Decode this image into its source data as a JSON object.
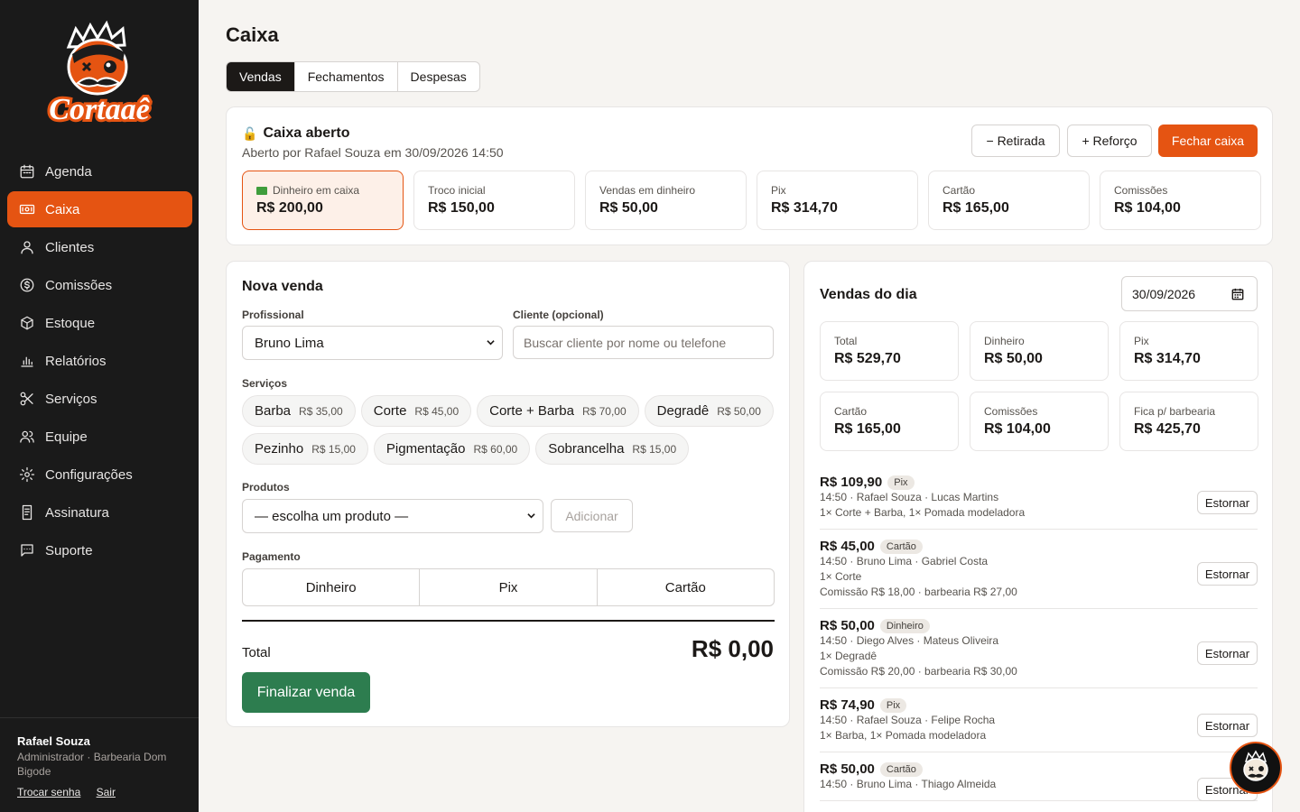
{
  "app": {
    "brand": "Cortaaê"
  },
  "sidebar": {
    "items": [
      {
        "label": "Agenda",
        "icon": "calendar-icon"
      },
      {
        "label": "Caixa",
        "icon": "cash-register-icon"
      },
      {
        "label": "Clientes",
        "icon": "user-icon"
      },
      {
        "label": "Comissões",
        "icon": "dollar-circle-icon"
      },
      {
        "label": "Estoque",
        "icon": "box-icon"
      },
      {
        "label": "Relatórios",
        "icon": "bar-chart-icon"
      },
      {
        "label": "Serviços",
        "icon": "scissors-icon"
      },
      {
        "label": "Equipe",
        "icon": "users-icon"
      },
      {
        "label": "Configurações",
        "icon": "gear-icon"
      },
      {
        "label": "Assinatura",
        "icon": "receipt-icon"
      },
      {
        "label": "Suporte",
        "icon": "chat-icon"
      }
    ],
    "active_index": 1,
    "user": {
      "name": "Rafael Souza",
      "role": "Administrador · Barbearia Dom Bigode",
      "change_password": "Trocar senha",
      "logout": "Sair"
    }
  },
  "page": {
    "title": "Caixa",
    "tabs": [
      "Vendas",
      "Fechamentos",
      "Despesas"
    ],
    "active_tab": 0
  },
  "status": {
    "title": "Caixa aberto",
    "subtitle": "Aberto por Rafael Souza em 30/09/2026 14:50",
    "retirada": "− Retirada",
    "reforco": "+ Reforço",
    "fechar": "Fechar caixa",
    "stats": [
      {
        "label": "Dinheiro em caixa",
        "value": "R$ 200,00"
      },
      {
        "label": "Troco inicial",
        "value": "R$ 150,00"
      },
      {
        "label": "Vendas em dinheiro",
        "value": "R$ 50,00"
      },
      {
        "label": "Pix",
        "value": "R$ 314,70"
      },
      {
        "label": "Cartão",
        "value": "R$ 165,00"
      },
      {
        "label": "Comissões",
        "value": "R$ 104,00"
      }
    ]
  },
  "sale": {
    "title": "Nova venda",
    "professional_label": "Profissional",
    "professional_value": "Bruno Lima",
    "client_label": "Cliente (opcional)",
    "client_placeholder": "Buscar cliente por nome ou telefone",
    "services_label": "Serviços",
    "services": [
      {
        "name": "Barba",
        "price": "R$ 35,00"
      },
      {
        "name": "Corte",
        "price": "R$ 45,00"
      },
      {
        "name": "Corte + Barba",
        "price": "R$ 70,00"
      },
      {
        "name": "Degradê",
        "price": "R$ 50,00"
      },
      {
        "name": "Pezinho",
        "price": "R$ 15,00"
      },
      {
        "name": "Pigmentação",
        "price": "R$ 60,00"
      },
      {
        "name": "Sobrancelha",
        "price": "R$ 15,00"
      }
    ],
    "products_label": "Produtos",
    "product_select": "— escolha um produto —",
    "add_button": "Adicionar",
    "payment_label": "Pagamento",
    "payment_options": [
      "Dinheiro",
      "Pix",
      "Cartão"
    ],
    "total_label": "Total",
    "total_value": "R$ 0,00",
    "finish_button": "Finalizar venda"
  },
  "day": {
    "title": "Vendas do dia",
    "date": "30/09/2026",
    "stats": [
      {
        "label": "Total",
        "value": "R$ 529,70"
      },
      {
        "label": "Dinheiro",
        "value": "R$ 50,00"
      },
      {
        "label": "Pix",
        "value": "R$ 314,70"
      },
      {
        "label": "Cartão",
        "value": "R$ 165,00"
      },
      {
        "label": "Comissões",
        "value": "R$ 104,00"
      },
      {
        "label": "Fica p/ barbearia",
        "value": "R$ 425,70"
      }
    ],
    "refund_label": "Estornar",
    "sales": [
      {
        "amount": "R$ 109,90",
        "method": "Pix",
        "lines": [
          "14:50 · Rafael Souza · Lucas Martins",
          "1× Corte + Barba, 1× Pomada modeladora"
        ]
      },
      {
        "amount": "R$ 45,00",
        "method": "Cartão",
        "lines": [
          "14:50 · Bruno Lima · Gabriel Costa",
          "1× Corte",
          "Comissão R$ 18,00 · barbearia R$ 27,00"
        ]
      },
      {
        "amount": "R$ 50,00",
        "method": "Dinheiro",
        "lines": [
          "14:50 · Diego Alves · Mateus Oliveira",
          "1× Degradê",
          "Comissão R$ 20,00 · barbearia R$ 30,00"
        ]
      },
      {
        "amount": "R$ 74,90",
        "method": "Pix",
        "lines": [
          "14:50 · Rafael Souza · Felipe Rocha",
          "1× Barba, 1× Pomada modeladora"
        ]
      },
      {
        "amount": "R$ 50,00",
        "method": "Cartão",
        "lines": [
          "14:50 · Bruno Lima · Thiago Almeida"
        ]
      }
    ]
  },
  "colors": {
    "accent": "#e55412",
    "sidebar_bg": "#1a1a1a",
    "success": "#2d7d4f"
  }
}
